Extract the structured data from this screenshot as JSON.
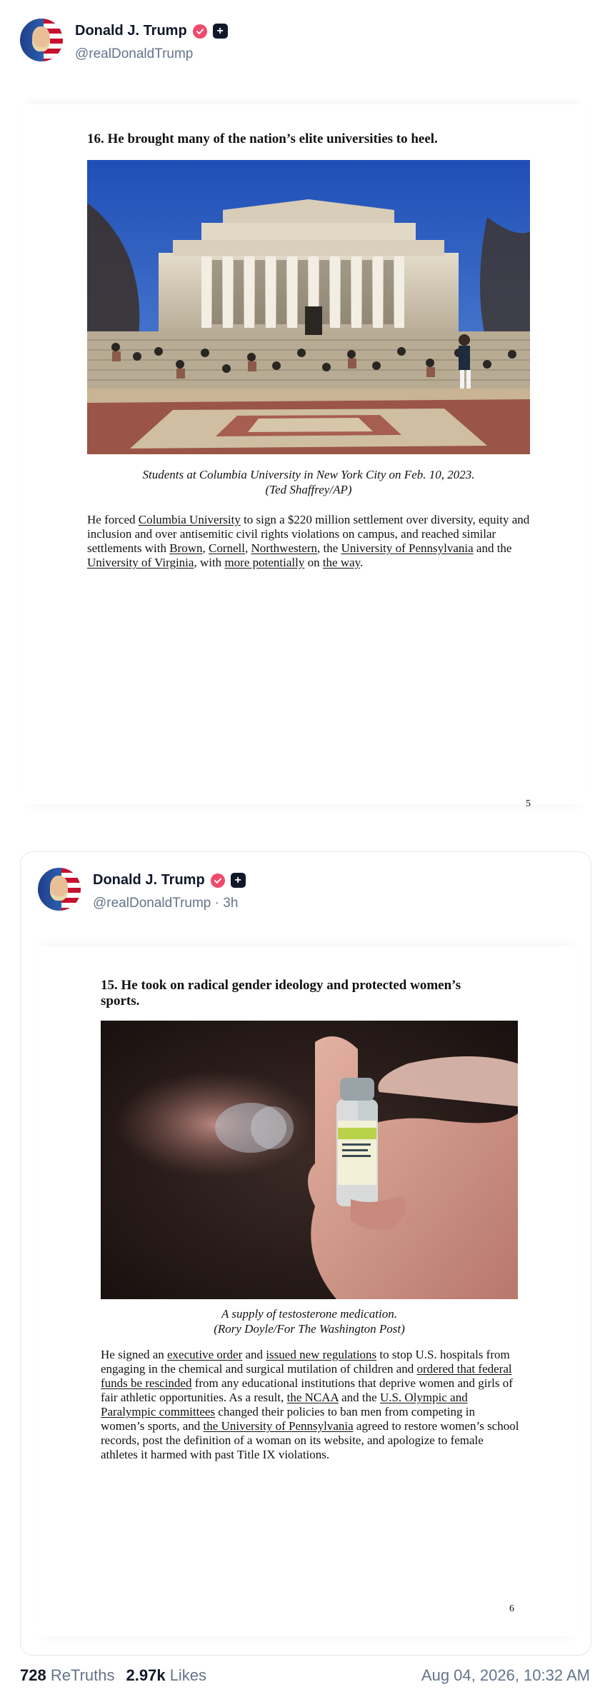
{
  "post1": {
    "author": {
      "name": "Donald J. Trump",
      "handle": "@realDonaldTrump"
    },
    "page": {
      "heading": "16. He brought many of the nation’s elite universities to heel.",
      "photo_icon": "columbia-library-photo",
      "caption_line1": "Students at Columbia University in New York City on Feb. 10, 2023.",
      "caption_line2": "(Ted Shaffrey/AP)",
      "body": {
        "t1": "He forced ",
        "l1": "Columbia University",
        "t2": " to sign a $220 million settlement over diversity, equity and inclusion and over antisemitic civil rights violations on campus, and reached similar settlements with ",
        "l2": "Brown",
        "t3": ", ",
        "l3": "Cornell",
        "t4": ", ",
        "l4": "Northwestern",
        "t5": ", the ",
        "l5": "University of Pennsylvania",
        "t6": " and the ",
        "l6": "University of Virginia",
        "t7": ", with ",
        "l7": "more potentially",
        "t8": " on ",
        "l8": "the way",
        "t9": "."
      },
      "page_number": "5"
    }
  },
  "post2": {
    "author": {
      "name": "Donald J. Trump",
      "handle": "@realDonaldTrump",
      "time": "· 3h"
    },
    "page": {
      "heading_line1": "15. He took on radical gender ideology and protected women’s",
      "heading_line2": "sports.",
      "photo_icon": "testosterone-vial-photo",
      "caption_line1": "A supply of testosterone medication.",
      "caption_line2": "(Rory Doyle/For The Washington Post)",
      "body": {
        "t1": "He signed an ",
        "l1": "executive order",
        "t2": " and ",
        "l2": "issued new regulations",
        "t3": " to stop U.S. hospitals from engaging in the chemical and surgical mutilation of children and ",
        "l3": "ordered that federal funds be rescinded",
        "t4": " from any educational institutions that deprive women and girls of fair athletic opportunities. As a result, ",
        "l4": "the NCAA",
        "t5": " and the ",
        "l5": "U.S. Olympic and Paralympic committees",
        "t6": " changed their policies to ban men from competing in women’s sports, and ",
        "l6": "the University of Pennsylvania",
        "t7": " agreed to restore women’s school records, post the definition of a woman on its website, and apologize to female athletes it harmed with past Title IX violations."
      },
      "page_number": "6"
    }
  },
  "footer": {
    "retruths_count": "728",
    "retruths_label": "ReTruths",
    "likes_count": "2.97k",
    "likes_label": "Likes",
    "timestamp": "Aug 04, 2026, 10:32 AM"
  },
  "colors": {
    "verified": "#ef4a6b",
    "text": "#0f172a",
    "muted": "#64748b"
  }
}
